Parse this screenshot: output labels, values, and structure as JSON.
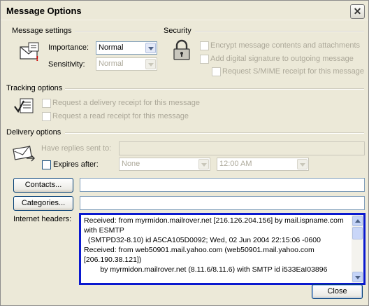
{
  "window": {
    "title": "Message Options",
    "close_glyph": "✕"
  },
  "message_settings": {
    "heading": "Message settings",
    "importance_label": "Importance:",
    "importance_value": "Normal",
    "sensitivity_label": "Sensitivity:",
    "sensitivity_value": "Normal",
    "icon": "envelope-settings-icon"
  },
  "security": {
    "heading": "Security",
    "encrypt_label": "Encrypt message contents and attachments",
    "signature_label": "Add digital signature to outgoing message",
    "smime_label": "Request S/MIME receipt for this message",
    "icon": "padlock-icon"
  },
  "tracking": {
    "heading": "Tracking options",
    "delivery_receipt_label": "Request a delivery receipt for this message",
    "read_receipt_label": "Request a read receipt for this message",
    "icon": "checklist-icon"
  },
  "delivery": {
    "heading": "Delivery options",
    "replies_label": "Have replies sent to:",
    "replies_value": "",
    "expires_label": "Expires after:",
    "expires_date": "None",
    "expires_time": "12:00 AM",
    "icon": "delivery-envelope-icon"
  },
  "contacts": {
    "button_label": "Contacts...",
    "value": ""
  },
  "categories": {
    "button_label": "Categories...",
    "value": ""
  },
  "internet_headers": {
    "label": "Internet headers:",
    "text": "Received: from myrmidon.mailrover.net [216.126.204.156] by mail.ispname.com with ESMTP\n  (SMTPD32-8.10) id A5CA105D0092; Wed, 02 Jun 2004 22:15:06 -0600\nReceived: from web50901.mail.yahoo.com (web50901.mail.yahoo.com [206.190.38.121])\n        by myrmidon.mailrover.net (8.11.6/8.11.6) with SMTP id i533EaI03896"
  },
  "footer": {
    "close_label": "Close"
  }
}
